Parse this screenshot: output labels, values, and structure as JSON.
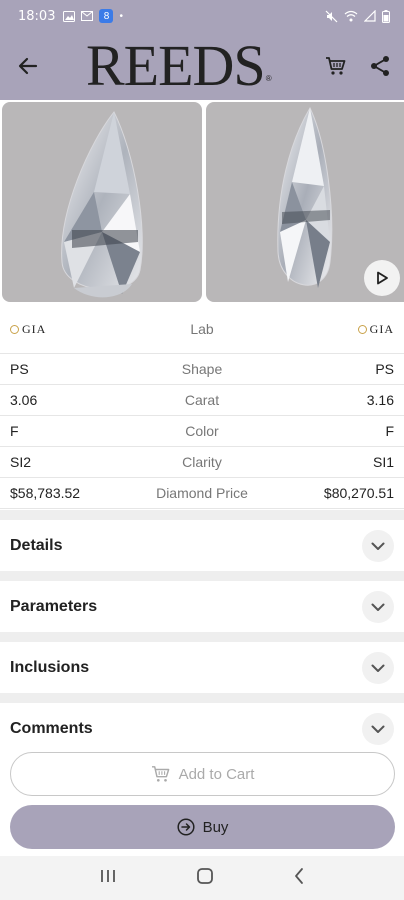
{
  "status_bar": {
    "time": "18:03",
    "notif_badge": "8"
  },
  "header": {
    "logo": "REEDS",
    "logo_mark": "®"
  },
  "compare": {
    "lab": {
      "left": "GIA",
      "label": "Lab",
      "right": "GIA"
    },
    "rows": [
      {
        "left": "PS",
        "label": "Shape",
        "right": "PS"
      },
      {
        "left": "3.06",
        "label": "Carat",
        "right": "3.16"
      },
      {
        "left": "F",
        "label": "Color",
        "right": "F"
      },
      {
        "left": "SI2",
        "label": "Clarity",
        "right": "SI1"
      },
      {
        "left": "$58,783.52",
        "label": "Diamond Price",
        "right": "$80,270.51"
      }
    ]
  },
  "sections": [
    {
      "label": "Details"
    },
    {
      "label": "Parameters"
    },
    {
      "label": "Inclusions"
    },
    {
      "label": "Comments"
    }
  ],
  "actions": {
    "add_to_cart": "Add to Cart",
    "buy": "Buy"
  },
  "colors": {
    "brand": "#a8a3b9",
    "gia_gold": "#c9a24a"
  },
  "icons": [
    "back-arrow-icon",
    "cart-icon",
    "share-icon",
    "play-icon",
    "chevron-down-icon",
    "buy-arrow-icon",
    "recents-icon",
    "home-icon",
    "nav-back-icon"
  ]
}
